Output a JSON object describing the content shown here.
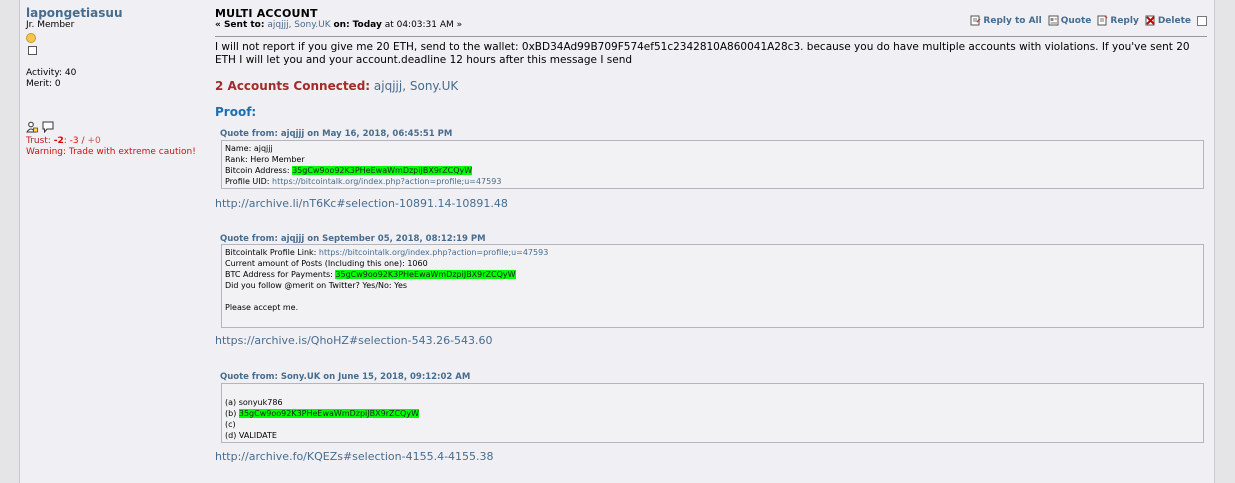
{
  "poster": {
    "username": "lapongetiasuu",
    "rank": "Jr. Member",
    "activity": "Activity: 40",
    "merit": "Merit: 0",
    "trust_label": "Trust:",
    "trust_neg": "-2",
    "trust_neg2": "-3",
    "trust_sep": "/",
    "trust_pos": "+0",
    "warning": "Warning: Trade with extreme caution!"
  },
  "post": {
    "subject": "MULTI ACCOUNT",
    "meta_prefix": "« Sent to:",
    "recipients": "ajqjjj, Sony.UK",
    "on_label": "on:",
    "date_bold": "Today",
    "time": "at 04:03:31 AM »",
    "actions": {
      "reply_all": "Reply to All",
      "quote": "Quote",
      "reply": "Reply",
      "delete": "Delete"
    },
    "body": "I will not report if you give me 20 ETH, send to the wallet: 0xBD34Ad99B709F574ef51c2342810A860041A28c3. because you do have multiple accounts with violations. If you've sent 20 ETH I will let you and your account.deadline 12 hours after this message I send",
    "connected_label": "2 Accounts Connected:",
    "connected_accounts": "ajqjjj, Sony.UK",
    "proof_label": "Proof:"
  },
  "quotes": [
    {
      "header": "Quote from: ajqjjj on May 16, 2018, 06:45:51 PM",
      "lines": {
        "name": "Name: ajqjjj",
        "rank": "Rank: Hero Member",
        "btc_label": "Bitcoin Address:",
        "btc": "35gCw9oo92K3PHeEwaWmDzpiJBX9rZCQyW",
        "uid_label": "Profile UID:",
        "uid_link": "https://bitcointalk.org/index.php?action=profile;u=47593"
      },
      "link": "http://archive.li/nT6Kc#selection-10891.14-10891.48"
    },
    {
      "header": "Quote from: ajqjjj on September 05, 2018, 08:12:19 PM",
      "lines": {
        "profile_label": "Bitcointalk Profile Link:",
        "profile_link": "https://bitcointalk.org/index.php?action=profile;u=47593",
        "posts": "Current amount of Posts (Including this one): 1060",
        "btc_label": "BTC Address for Payments:",
        "btc": "35gCw9oo92K3PHeEwaWmDzpiJBX9rZCQyW",
        "twitter": "Did you follow @merit on Twitter? Yes/No: Yes",
        "accept": "Please accept me."
      },
      "link": "https://archive.is/QhoHZ#selection-543.26-543.60"
    },
    {
      "header": "Quote from: Sony.UK on June 15, 2018, 09:12:02 AM",
      "lines": {
        "a": "(a) sonyuk786",
        "b_label": "(b)",
        "b": "35gCw9oo92K3PHeEwaWmDzpiJBX9rZCQyW",
        "c": "(c)",
        "d": "(d) VALIDATE"
      },
      "link": "http://archive.fo/KQEZs#selection-4155.4-4155.38"
    }
  ]
}
